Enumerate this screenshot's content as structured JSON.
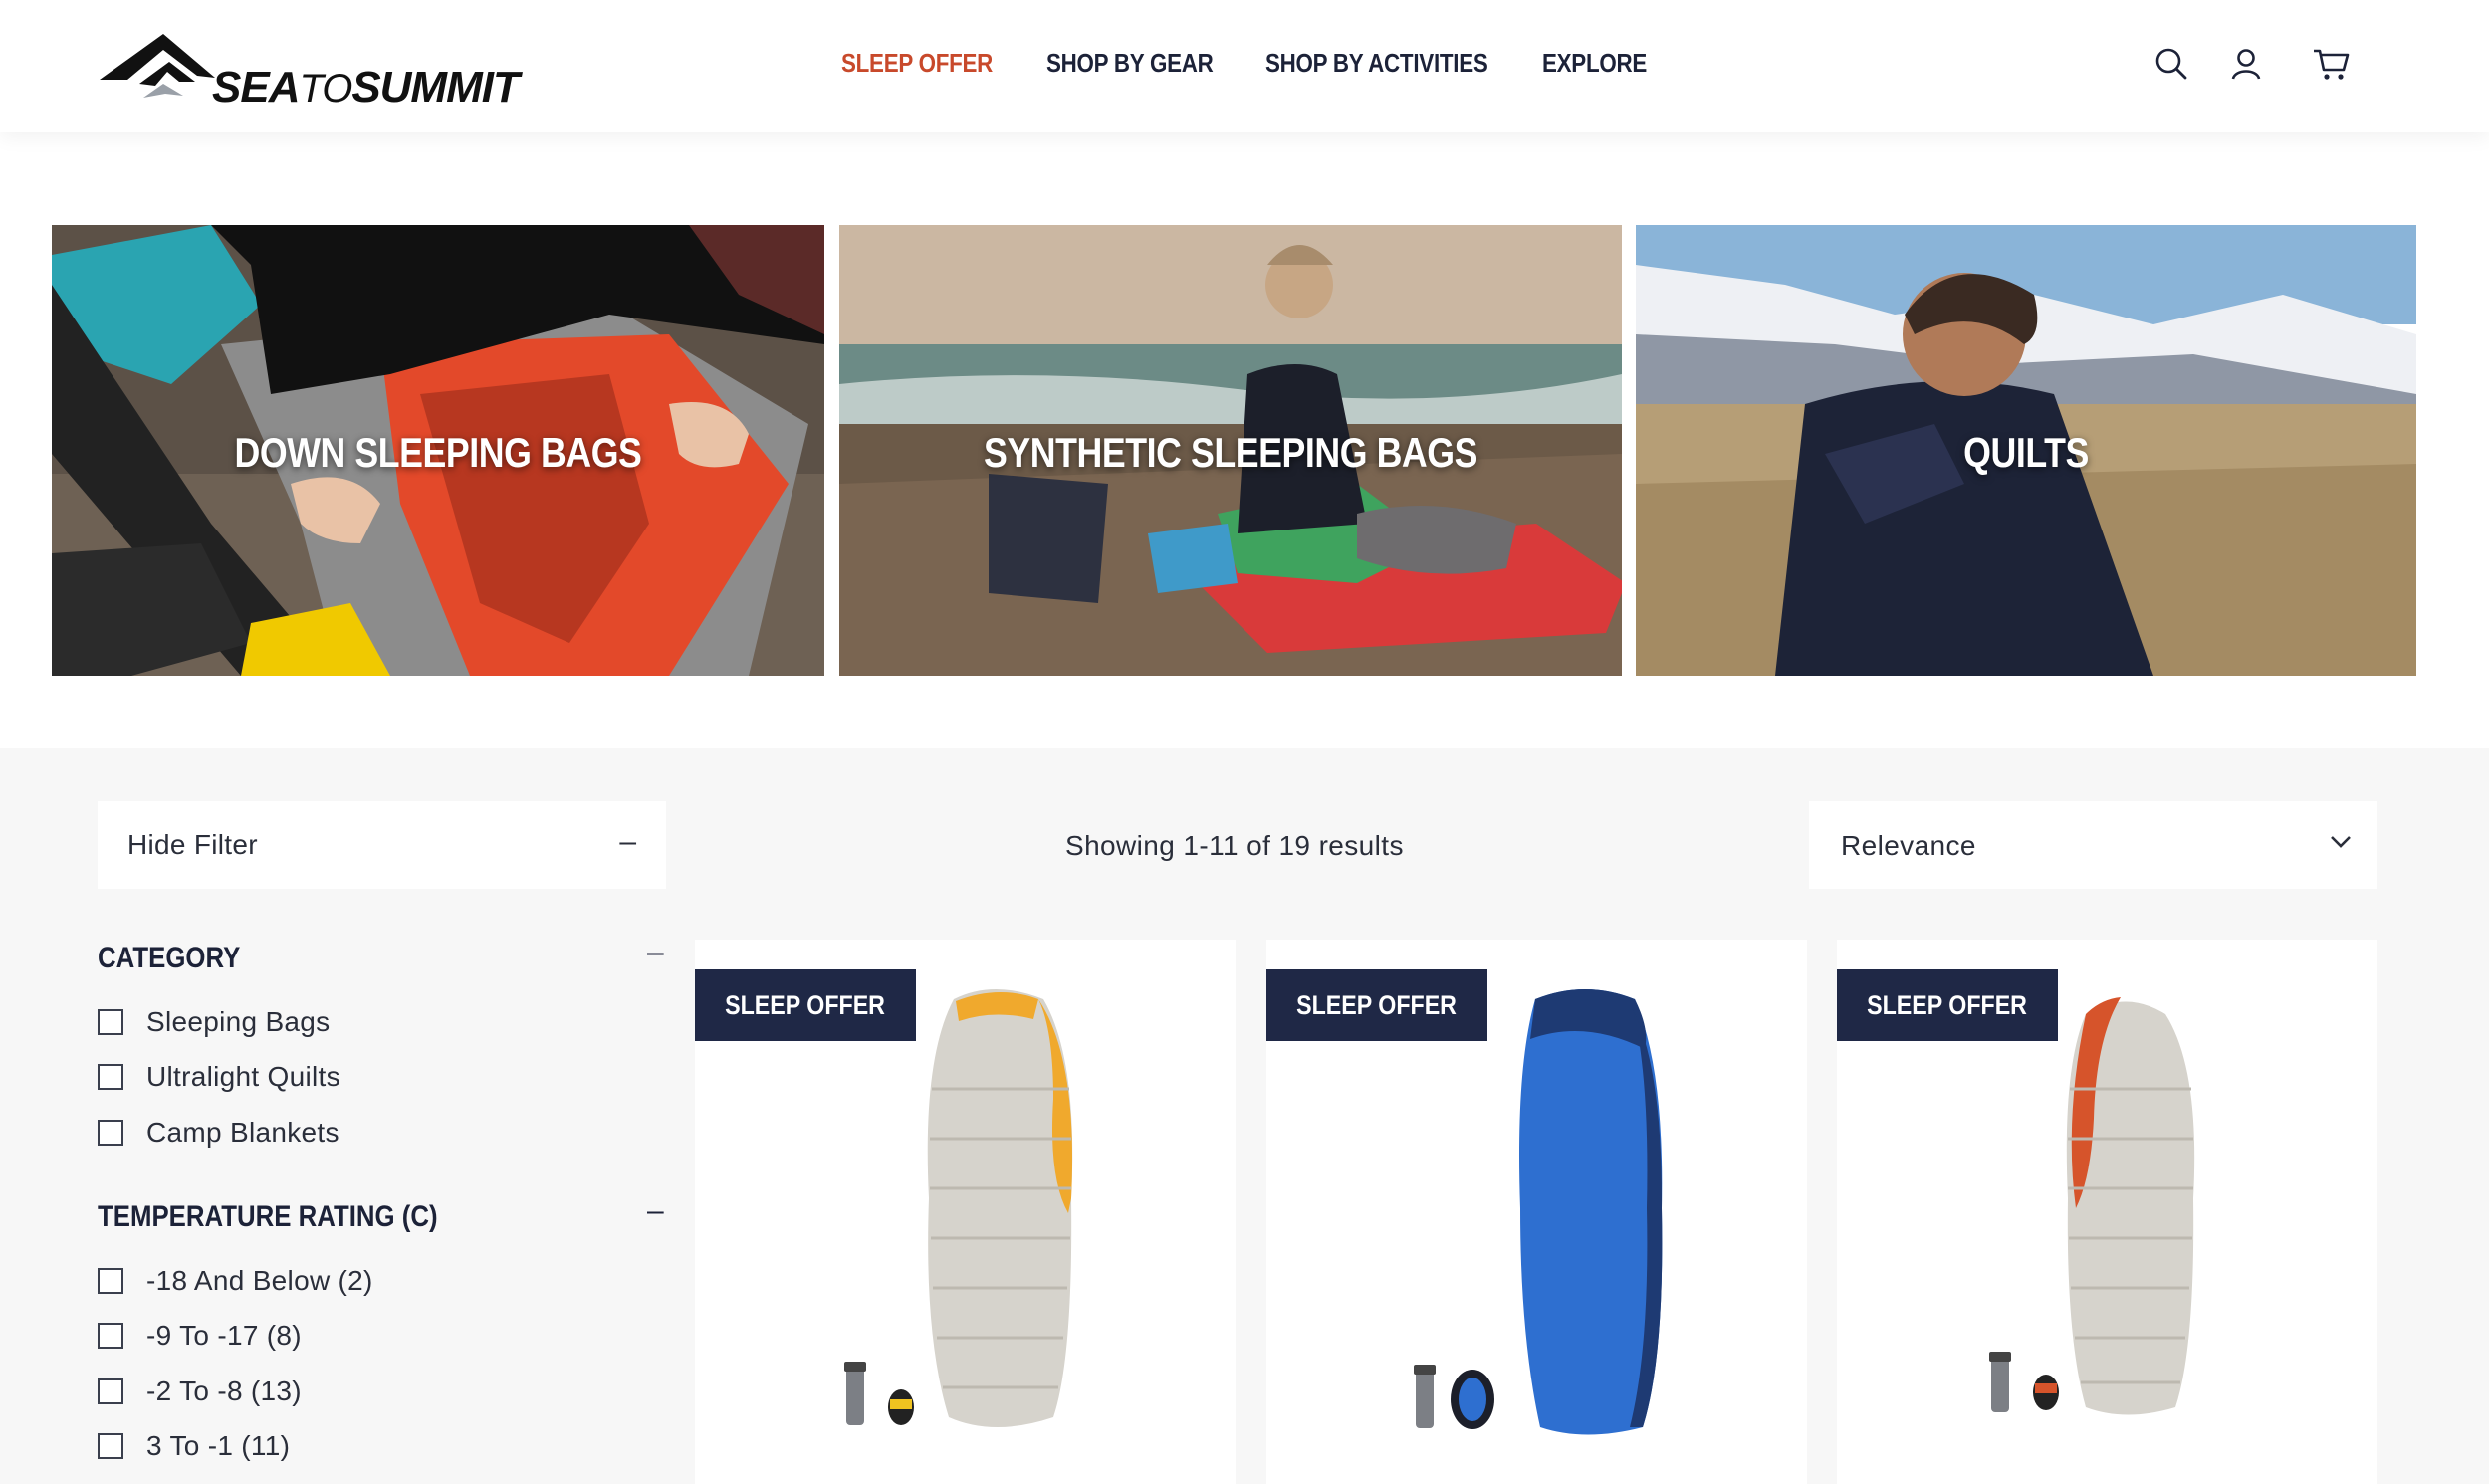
{
  "brand": {
    "name_part1": "SEA",
    "name_part2": "TO",
    "name_part3": "SUMMIT"
  },
  "nav": {
    "items": [
      {
        "label": "SLEEP OFFER",
        "active": true
      },
      {
        "label": "SHOP BY GEAR",
        "active": false
      },
      {
        "label": "SHOP BY ACTIVITIES",
        "active": false
      },
      {
        "label": "EXPLORE",
        "active": false
      }
    ],
    "icons": [
      "search-icon",
      "account-icon",
      "cart-icon"
    ]
  },
  "categories": [
    {
      "label": "DOWN SLEEPING BAGS"
    },
    {
      "label": "SYNTHETIC SLEEPING BAGS"
    },
    {
      "label": "QUILTS"
    }
  ],
  "toolbar": {
    "hide_filter_label": "Hide Filter",
    "hide_filter_toggle": "–",
    "results_text": "Showing 1-11 of 19 results",
    "sort_label": "Relevance"
  },
  "filters": {
    "category": {
      "title": "CATEGORY",
      "toggle": "–",
      "options": [
        "Sleeping Bags",
        "Ultralight Quilts",
        "Camp Blankets"
      ]
    },
    "temperature": {
      "title": "TEMPERATURE RATING (C)",
      "toggle": "–",
      "options": [
        "-18 And Below (2)",
        "-9 To -17 (8)",
        "-2 To -8 (13)",
        "3 To -1 (11)"
      ]
    }
  },
  "products": [
    {
      "badge": "SLEEP OFFER",
      "accent": "#f0a92d",
      "body": "#d6d3cc"
    },
    {
      "badge": "SLEEP OFFER",
      "accent": "#1e3a73",
      "body": "#2e6fd0"
    },
    {
      "badge": "SLEEP OFFER",
      "accent": "#d6542b",
      "body": "#d6d3cc"
    }
  ],
  "colors": {
    "accent": "#c8492b",
    "navy": "#1f2846",
    "bg": "#f7f7f7"
  }
}
